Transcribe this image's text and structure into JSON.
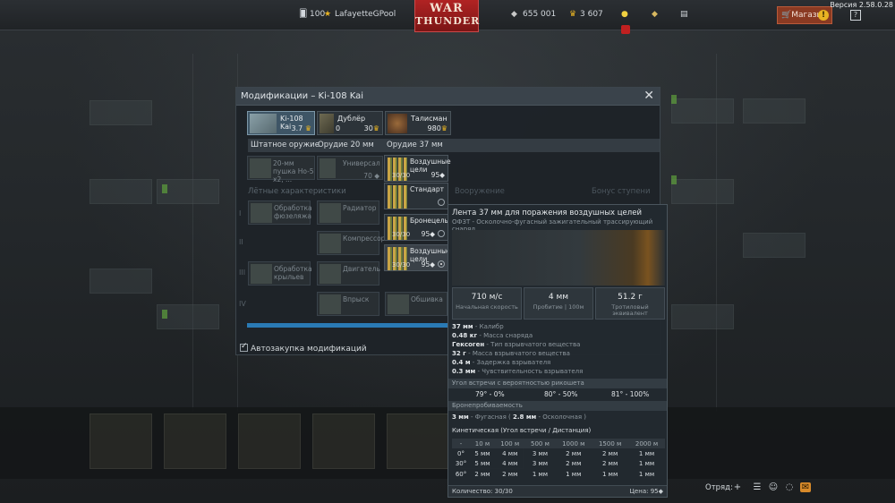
{
  "topbar": {
    "level": "100",
    "username": "LafayetteGPool",
    "silver_lions": "655 001",
    "golden_eagles": "3 607",
    "logo_line1": "WAR",
    "logo_line2": "THUNDER",
    "shop_label": "Магазин",
    "shop_badge": "!",
    "help_label": "?",
    "version": "Версия 2.58.0.28"
  },
  "modal": {
    "title": "Модификации – Ki-108 Kai",
    "close": "✕",
    "cards": [
      {
        "name": "Ki-108 Kai",
        "value": "3.7"
      },
      {
        "name": "Дублёр",
        "value_left": "0",
        "value": "30"
      },
      {
        "name": "Талисман",
        "value": "980"
      }
    ],
    "tabs": [
      "Штатное оружие",
      "Орудие 20 мм",
      "Орудие 37 мм"
    ],
    "weapon_row": {
      "cannon": "20-мм пушка Ho-5 х2, ...",
      "universal": "Универсал",
      "universal_price": "70"
    },
    "flight_header": "Лётные характеристики",
    "armament_header": "Вооружение",
    "bonus_header": "Бонус ступени",
    "tiers": [
      "I",
      "II",
      "III",
      "IV"
    ],
    "mods": [
      "Обработка фюзеляжа",
      "Радиатор",
      "Компрессор",
      "Обработка крыльев",
      "Двигатель",
      "Впрыск",
      "Обшивка"
    ],
    "auto_buy": "Автозакупка модификаций"
  },
  "ammo": [
    {
      "name": "Воздушные цели",
      "count": "30/30",
      "price": "95"
    },
    {
      "name": "Стандарт",
      "count": ""
    },
    {
      "name": "Бронецель",
      "count": "30/30",
      "price": "95"
    },
    {
      "name": "Воздушные цели",
      "count": "30/30",
      "price": "95"
    }
  ],
  "tooltip": {
    "title": "Лента 37 мм для поражения воздушных целей",
    "subtitle": "ОФЗТ - Осколочно-фугасный зажигательный трассирующий снаряд",
    "stats": [
      {
        "value": "710 м/с",
        "label": "Начальная скорость"
      },
      {
        "value": "4 мм",
        "label": "Пробитие | 100м"
      },
      {
        "value": "51.2 г",
        "label": "Тротиловый эквивалент"
      }
    ],
    "params": [
      {
        "value": "37 мм",
        "label": " - Калибр"
      },
      {
        "value": "0.48 кг",
        "label": " - Масса снаряда"
      },
      {
        "value": "Гексоген",
        "label": " - Тип взрывчатого вещества"
      },
      {
        "value": "32 г",
        "label": " - Масса взрывчатого вещества"
      },
      {
        "value": "0.4 м",
        "label": " - Задержка взрывателя"
      },
      {
        "value": "0.3 мм",
        "label": " - Чувствительность взрывателя"
      }
    ],
    "ricochet_header": "Угол встречи с вероятностью рикошета",
    "ricochet": [
      "79° - 0%",
      "80° - 50%",
      "81° - 100%"
    ],
    "penetration_header": "Бронепробиваемость",
    "pen_a": "3 мм",
    "pen_b": " - Фугасная ( ",
    "pen_c": "2.8 мм",
    "pen_d": " - Осколочная )",
    "kinetic_header": "Кинетическая (Угол встречи / Дистанция)",
    "table_headers": [
      "-",
      "10 м",
      "100 м",
      "500 м",
      "1000 м",
      "1500 м",
      "2000 м"
    ],
    "table_rows": [
      [
        "0°",
        "5 мм",
        "4 мм",
        "3 мм",
        "2 мм",
        "2 мм",
        "1 мм"
      ],
      [
        "30°",
        "5 мм",
        "4 мм",
        "3 мм",
        "2 мм",
        "2 мм",
        "1 мм"
      ],
      [
        "60°",
        "2 мм",
        "2 мм",
        "1 мм",
        "1 мм",
        "1 мм",
        "1 мм"
      ]
    ],
    "quantity": "Количество: 30/30",
    "price": "Цена: 95"
  },
  "bottom": {
    "squad_label": "Отряд:"
  }
}
